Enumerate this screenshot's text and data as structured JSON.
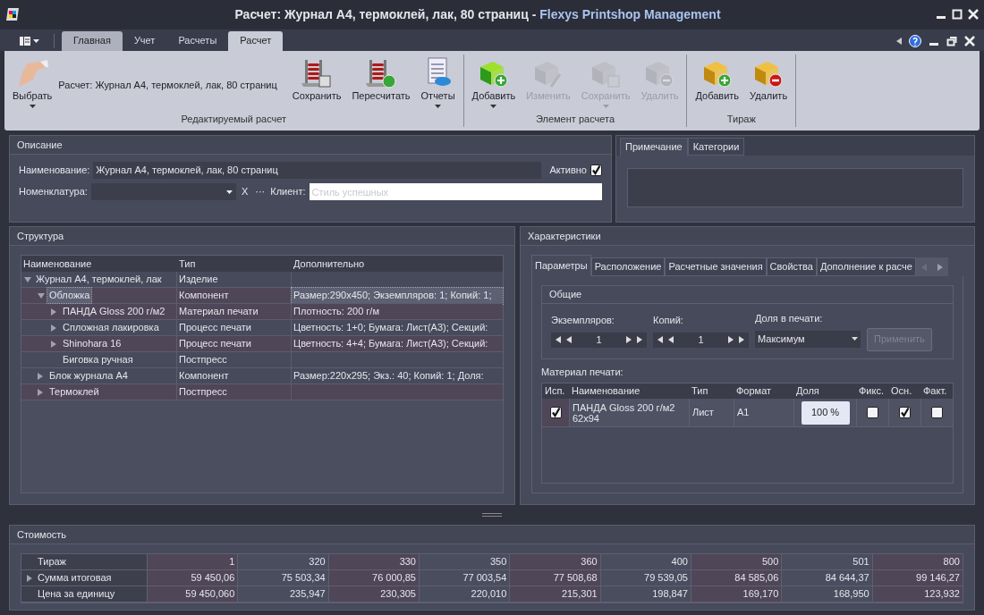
{
  "window": {
    "title": "Расчет: Журнал А4, термоклей, лак, 80 страниц",
    "separator": " - ",
    "app_name": "Flexys Printshop Management"
  },
  "ribbon_tabs": [
    {
      "label": "Главная",
      "selected": false
    },
    {
      "label": "Учет",
      "selected": false
    },
    {
      "label": "Расчеты",
      "selected": false
    },
    {
      "label": "Расчет",
      "selected": true
    }
  ],
  "ribbon_groups": [
    {
      "title": "Редактируемый расчет",
      "caption": "Расчет: Журнал А4, термоклей, лак, 80 страниц",
      "buttons": [
        {
          "label": "Выбрать",
          "disabled": false,
          "dropdown": true
        },
        {
          "label": "Сохранить",
          "disabled": false,
          "dropdown": false
        },
        {
          "label": "Пересчитать",
          "disabled": false,
          "dropdown": false
        },
        {
          "label": "Отчеты",
          "disabled": false,
          "dropdown": true
        }
      ]
    },
    {
      "title": "Элемент расчета",
      "buttons": [
        {
          "label": "Добавить",
          "disabled": false,
          "dropdown": true
        },
        {
          "label": "Изменить",
          "disabled": true,
          "dropdown": false
        },
        {
          "label": "Сохранить",
          "disabled": true,
          "dropdown": true
        },
        {
          "label": "Удалить",
          "disabled": true,
          "dropdown": false
        }
      ]
    },
    {
      "title": "Тираж",
      "buttons": [
        {
          "label": "Добавить",
          "disabled": false,
          "dropdown": false
        },
        {
          "label": "Удалить",
          "disabled": false,
          "dropdown": false
        }
      ]
    }
  ],
  "description": {
    "title": "Описание",
    "name_label": "Наименование:",
    "name_value": "Журнал А4, термоклей, лак, 80 страниц",
    "active_label": "Активно",
    "active": true,
    "nomenclature_label": "Номенклатура:",
    "clear": "X",
    "more": "···",
    "client_label": "Клиент:",
    "client_placeholder": "Стиль успешных"
  },
  "notes": {
    "tabs": [
      {
        "label": "Примечание",
        "selected": true
      },
      {
        "label": "Категории",
        "selected": false
      }
    ]
  },
  "structure": {
    "title": "Структура",
    "columns": [
      "Наименование",
      "Тип",
      "Дополнительно"
    ],
    "rows": [
      {
        "name": "Журнал А4, термоклей, лак",
        "type": "Изделие",
        "has_children": true,
        "expanded": true,
        "selected": false,
        "children": [
          {
            "name": "Обложка",
            "type": "Компонент",
            "extra": "Размер:290x450; Экземпляров: 1; Копий: 1;",
            "has_children": true,
            "expanded": true,
            "selected": true,
            "children": [
              {
                "name": "ПАНДА Gloss 200 г/м2",
                "type": "Материал печати",
                "extra": "Плотность: 200 г/м",
                "has_children": true,
                "expanded": false,
                "selected": false
              },
              {
                "name": "Спложная лакировка",
                "type": "Процесс печати",
                "extra": "Цветность: 1+0; Бумага: Лист(А3); Секций:",
                "has_children": true,
                "expanded": false,
                "selected": false
              },
              {
                "name": "Shinohara 16",
                "type": "Процесс печати",
                "extra": "Цветность: 4+4; Бумага: Лист(А3); Секций:",
                "has_children": true,
                "expanded": false,
                "selected": false
              },
              {
                "name": "Биговка ручная",
                "type": "Постпресс",
                "has_children": false,
                "expanded": false,
                "selected": false
              }
            ]
          },
          {
            "name": "Блок журнала А4",
            "type": "Компонент",
            "extra": "Размер:220x295; Экз.: 40; Копий: 1; Доля:",
            "has_children": true,
            "expanded": false,
            "selected": false
          },
          {
            "name": "Термоклей",
            "type": "Постпресс",
            "has_children": true,
            "expanded": false,
            "selected": false
          }
        ]
      }
    ]
  },
  "characteristics": {
    "title": "Характеристики",
    "tabs": [
      {
        "label": "Параметры",
        "selected": true
      },
      {
        "label": "Расположение",
        "selected": false
      },
      {
        "label": "Расчетные значения",
        "selected": false
      },
      {
        "label": "Свойства",
        "selected": false
      },
      {
        "label": "Дополнение к расче",
        "selected": false
      }
    ],
    "general": {
      "title": "Общие",
      "copies_label": "Экземпляров:",
      "copies": "1",
      "prints_label": "Копий:",
      "prints": "1",
      "share_label": "Доля в печати:",
      "share": "Максимум",
      "apply": "Применить",
      "apply_disabled": true
    },
    "material_label": "Материал печати:",
    "material_columns": [
      "Исп.",
      "Наименование",
      "Тип",
      "Формат",
      "Доля",
      "Фикс.",
      "Осн.",
      "Факт."
    ],
    "material_rows": [
      {
        "used": true,
        "name": "ПАНДА Gloss 200 г/м2 62x94",
        "type": "Лист",
        "format": "A1",
        "share": "100 %",
        "fixed": false,
        "main": true,
        "actual": false
      }
    ]
  },
  "cost": {
    "title": "Стоимость",
    "rows": [
      {
        "label": "Тираж",
        "expandable": false,
        "values": [
          "1",
          "320",
          "330",
          "350",
          "360",
          "400",
          "500",
          "501",
          "800"
        ]
      },
      {
        "label": "Сумма итоговая",
        "expandable": true,
        "values": [
          "59 450,06",
          "75 503,34",
          "76 000,85",
          "77 003,54",
          "77 508,68",
          "79 539,05",
          "84 585,06",
          "84 644,37",
          "99 146,27"
        ]
      },
      {
        "label": "Цена за единицу",
        "expandable": false,
        "values": [
          "59 450,060",
          "235,947",
          "230,305",
          "220,010",
          "215,301",
          "198,847",
          "169,170",
          "168,950",
          "123,932"
        ]
      }
    ]
  }
}
